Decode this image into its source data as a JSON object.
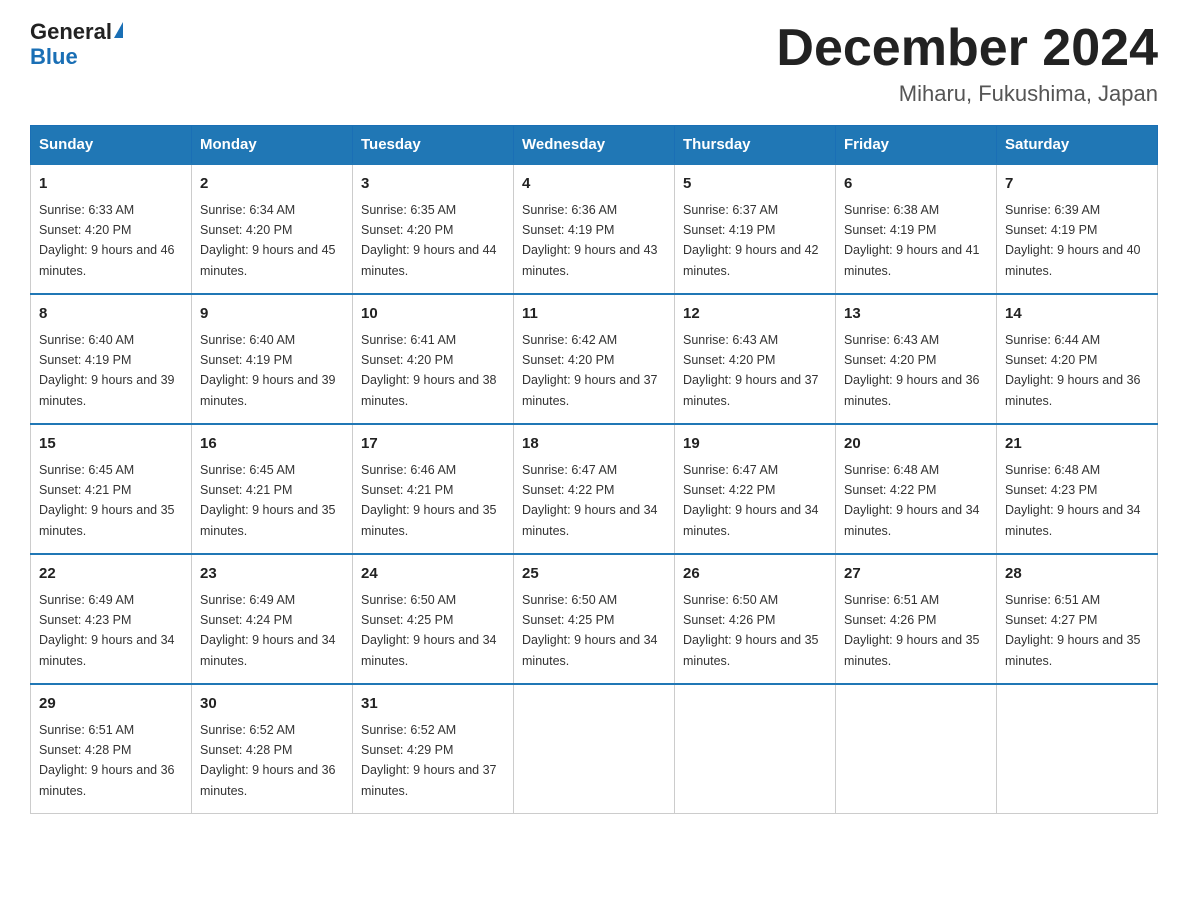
{
  "logo": {
    "general": "General",
    "blue": "Blue"
  },
  "title": "December 2024",
  "subtitle": "Miharu, Fukushima, Japan",
  "headers": [
    "Sunday",
    "Monday",
    "Tuesday",
    "Wednesday",
    "Thursday",
    "Friday",
    "Saturday"
  ],
  "weeks": [
    [
      {
        "day": "1",
        "sunrise": "6:33 AM",
        "sunset": "4:20 PM",
        "daylight": "9 hours and 46 minutes."
      },
      {
        "day": "2",
        "sunrise": "6:34 AM",
        "sunset": "4:20 PM",
        "daylight": "9 hours and 45 minutes."
      },
      {
        "day": "3",
        "sunrise": "6:35 AM",
        "sunset": "4:20 PM",
        "daylight": "9 hours and 44 minutes."
      },
      {
        "day": "4",
        "sunrise": "6:36 AM",
        "sunset": "4:19 PM",
        "daylight": "9 hours and 43 minutes."
      },
      {
        "day": "5",
        "sunrise": "6:37 AM",
        "sunset": "4:19 PM",
        "daylight": "9 hours and 42 minutes."
      },
      {
        "day": "6",
        "sunrise": "6:38 AM",
        "sunset": "4:19 PM",
        "daylight": "9 hours and 41 minutes."
      },
      {
        "day": "7",
        "sunrise": "6:39 AM",
        "sunset": "4:19 PM",
        "daylight": "9 hours and 40 minutes."
      }
    ],
    [
      {
        "day": "8",
        "sunrise": "6:40 AM",
        "sunset": "4:19 PM",
        "daylight": "9 hours and 39 minutes."
      },
      {
        "day": "9",
        "sunrise": "6:40 AM",
        "sunset": "4:19 PM",
        "daylight": "9 hours and 39 minutes."
      },
      {
        "day": "10",
        "sunrise": "6:41 AM",
        "sunset": "4:20 PM",
        "daylight": "9 hours and 38 minutes."
      },
      {
        "day": "11",
        "sunrise": "6:42 AM",
        "sunset": "4:20 PM",
        "daylight": "9 hours and 37 minutes."
      },
      {
        "day": "12",
        "sunrise": "6:43 AM",
        "sunset": "4:20 PM",
        "daylight": "9 hours and 37 minutes."
      },
      {
        "day": "13",
        "sunrise": "6:43 AM",
        "sunset": "4:20 PM",
        "daylight": "9 hours and 36 minutes."
      },
      {
        "day": "14",
        "sunrise": "6:44 AM",
        "sunset": "4:20 PM",
        "daylight": "9 hours and 36 minutes."
      }
    ],
    [
      {
        "day": "15",
        "sunrise": "6:45 AM",
        "sunset": "4:21 PM",
        "daylight": "9 hours and 35 minutes."
      },
      {
        "day": "16",
        "sunrise": "6:45 AM",
        "sunset": "4:21 PM",
        "daylight": "9 hours and 35 minutes."
      },
      {
        "day": "17",
        "sunrise": "6:46 AM",
        "sunset": "4:21 PM",
        "daylight": "9 hours and 35 minutes."
      },
      {
        "day": "18",
        "sunrise": "6:47 AM",
        "sunset": "4:22 PM",
        "daylight": "9 hours and 34 minutes."
      },
      {
        "day": "19",
        "sunrise": "6:47 AM",
        "sunset": "4:22 PM",
        "daylight": "9 hours and 34 minutes."
      },
      {
        "day": "20",
        "sunrise": "6:48 AM",
        "sunset": "4:22 PM",
        "daylight": "9 hours and 34 minutes."
      },
      {
        "day": "21",
        "sunrise": "6:48 AM",
        "sunset": "4:23 PM",
        "daylight": "9 hours and 34 minutes."
      }
    ],
    [
      {
        "day": "22",
        "sunrise": "6:49 AM",
        "sunset": "4:23 PM",
        "daylight": "9 hours and 34 minutes."
      },
      {
        "day": "23",
        "sunrise": "6:49 AM",
        "sunset": "4:24 PM",
        "daylight": "9 hours and 34 minutes."
      },
      {
        "day": "24",
        "sunrise": "6:50 AM",
        "sunset": "4:25 PM",
        "daylight": "9 hours and 34 minutes."
      },
      {
        "day": "25",
        "sunrise": "6:50 AM",
        "sunset": "4:25 PM",
        "daylight": "9 hours and 34 minutes."
      },
      {
        "day": "26",
        "sunrise": "6:50 AM",
        "sunset": "4:26 PM",
        "daylight": "9 hours and 35 minutes."
      },
      {
        "day": "27",
        "sunrise": "6:51 AM",
        "sunset": "4:26 PM",
        "daylight": "9 hours and 35 minutes."
      },
      {
        "day": "28",
        "sunrise": "6:51 AM",
        "sunset": "4:27 PM",
        "daylight": "9 hours and 35 minutes."
      }
    ],
    [
      {
        "day": "29",
        "sunrise": "6:51 AM",
        "sunset": "4:28 PM",
        "daylight": "9 hours and 36 minutes."
      },
      {
        "day": "30",
        "sunrise": "6:52 AM",
        "sunset": "4:28 PM",
        "daylight": "9 hours and 36 minutes."
      },
      {
        "day": "31",
        "sunrise": "6:52 AM",
        "sunset": "4:29 PM",
        "daylight": "9 hours and 37 minutes."
      },
      null,
      null,
      null,
      null
    ]
  ]
}
